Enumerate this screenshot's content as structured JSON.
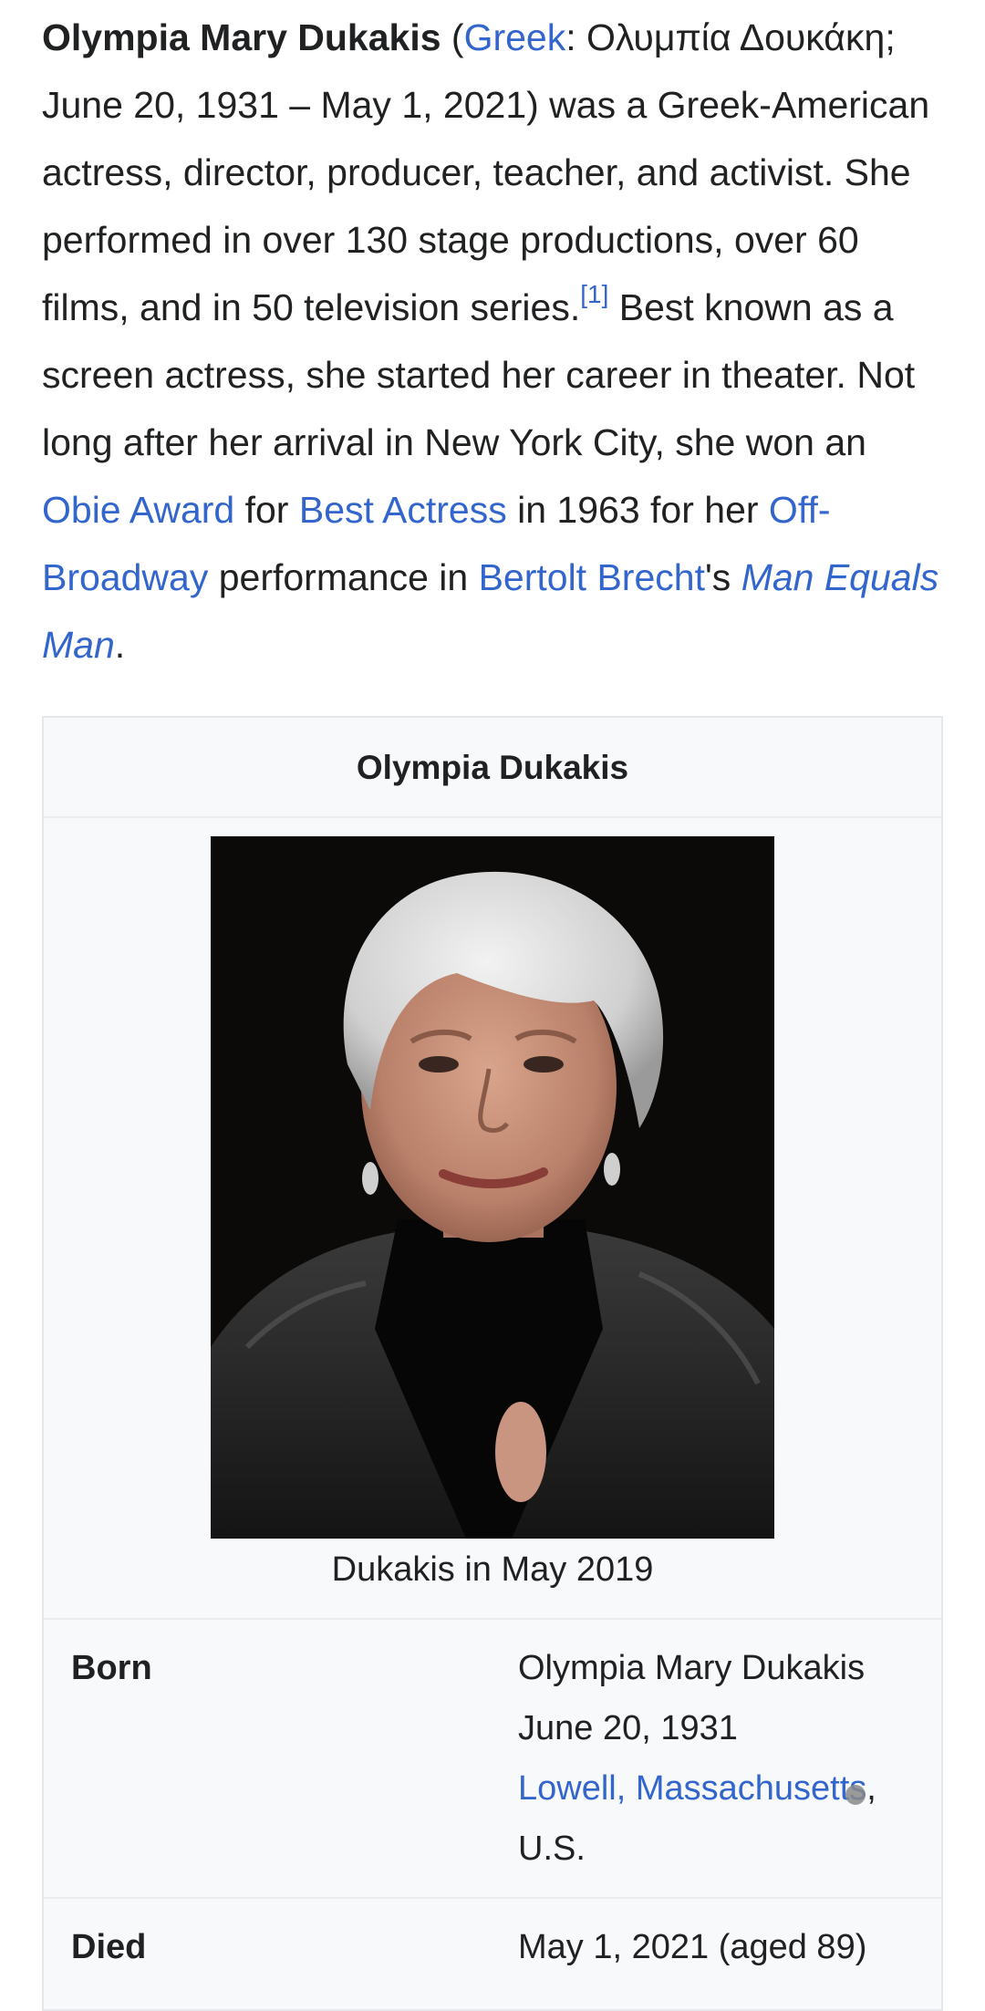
{
  "intro": {
    "name": "Olympia Mary Dukakis",
    "open_paren": " (",
    "greek_link": "Greek",
    "greek_text": ": Ολυμπία Δουκάκη; June 20, 1931 – May 1, 2021) was a Greek-American actress, director, producer, teacher, and activist. She performed in over 130 stage productions, over 60 films, and in 50 television series.",
    "ref": "[1]",
    "text2": " Best known as a screen actress, she started her career in theater. Not long after her arrival in New York City, she won an ",
    "link_obie": "Obie Award",
    "text3": " for ",
    "link_best_actress": "Best Actress",
    "text4": " in 1963 for her ",
    "link_off_broadway": "Off-Broadway",
    "text5": " performance in ",
    "link_brecht": "Bertolt Brecht",
    "text6": "'s ",
    "link_play": "Man Equals Man",
    "text7": "."
  },
  "infobox": {
    "title": "Olympia Dukakis",
    "image_alt": "portrait-photo",
    "caption": "Dukakis in May 2019",
    "born": {
      "label": "Born",
      "birth_name": "Olympia Mary Dukakis",
      "birth_date": "June 20, 1931",
      "birth_place_link": "Lowell, Massachusetts",
      "birth_place_comma": ",",
      "birth_country": "U.S."
    },
    "died": {
      "label": "Died",
      "value": "May 1, 2021 (aged 89)"
    }
  },
  "colors": {
    "link": "#3366cc",
    "text": "#202122",
    "infobox_bg": "#f8f9fa",
    "infobox_border": "#eaecf0"
  }
}
